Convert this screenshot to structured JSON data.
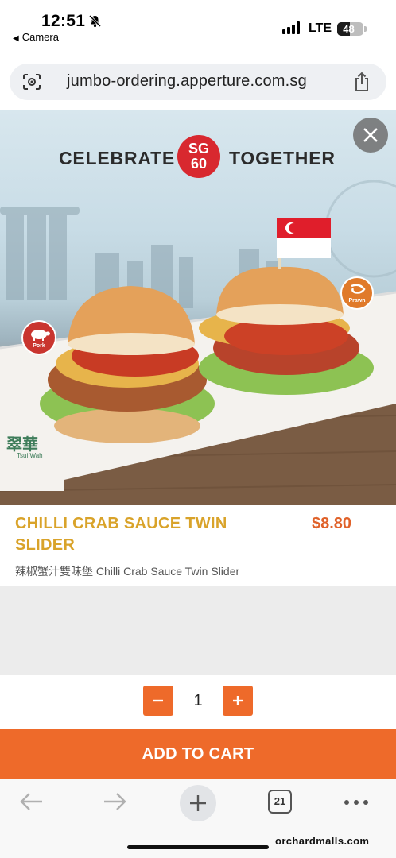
{
  "status_bar": {
    "time": "12:51",
    "back_app": "Camera",
    "network": "LTE",
    "battery": "48",
    "icons": [
      "bell-slash-icon",
      "signal-icon",
      "battery-icon"
    ]
  },
  "browser": {
    "url": "jumbo-ordering.apperture.com.sg",
    "tabs_count": "21",
    "icons": [
      "lens-icon",
      "share-icon",
      "back-arrow-icon",
      "forward-arrow-icon",
      "plus-icon",
      "more-icon"
    ]
  },
  "hero": {
    "headline_left": "CELEBRATE",
    "badge_top": "SG",
    "badge_bottom": "60",
    "headline_right": "TOGETHER",
    "pork_badge": "Pork",
    "prawn_badge": "Prawn",
    "brand_mark": "翠華",
    "brand_sub": "Tsui Wah"
  },
  "product": {
    "name": "CHILLI CRAB SAUCE TWIN SLIDER",
    "price": "$8.80",
    "description": "辣椒蟹汁雙味堡 Chilli Crab Sauce Twin Slider"
  },
  "quantity": {
    "value": "1"
  },
  "cart": {
    "button_label": "ADD TO CART"
  },
  "watermark": "orchardmalls.com",
  "colors": {
    "accent_orange": "#ee6a2a",
    "product_name_gold": "#d9a32a",
    "price_orange": "#e0622a",
    "sg_red": "#d8282f"
  }
}
